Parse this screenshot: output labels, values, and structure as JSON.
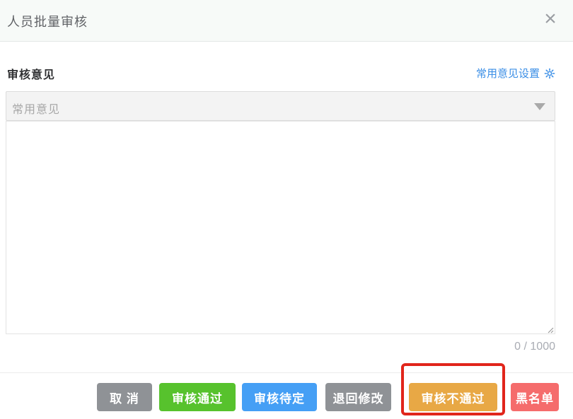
{
  "modal": {
    "title": "人员批量审核",
    "close_label": "×"
  },
  "review": {
    "section_label": "审核意见",
    "settings_link_label": "常用意见设置",
    "settings_icon": "gear-icon",
    "dropdown_placeholder": "常用意见",
    "textarea_value": "",
    "char_counter": "0 / 1000"
  },
  "colors": {
    "link_blue": "#3a8ee6",
    "highlight_red": "#e1251b",
    "header_bg": "#f7faf8"
  },
  "footer": {
    "buttons": [
      {
        "id": "cancel",
        "label": "取 消",
        "color": "#8f9296"
      },
      {
        "id": "approve",
        "label": "审核通过",
        "color": "#57c22d"
      },
      {
        "id": "pending",
        "label": "审核待定",
        "color": "#459ff5"
      },
      {
        "id": "return-modify",
        "label": "退回修改",
        "color": "#8f9296"
      },
      {
        "id": "reject",
        "label": "审核不通过",
        "color": "#e8a845",
        "highlighted": true
      },
      {
        "id": "blacklist",
        "label": "黑名单",
        "color": "#f56c6c"
      }
    ]
  }
}
